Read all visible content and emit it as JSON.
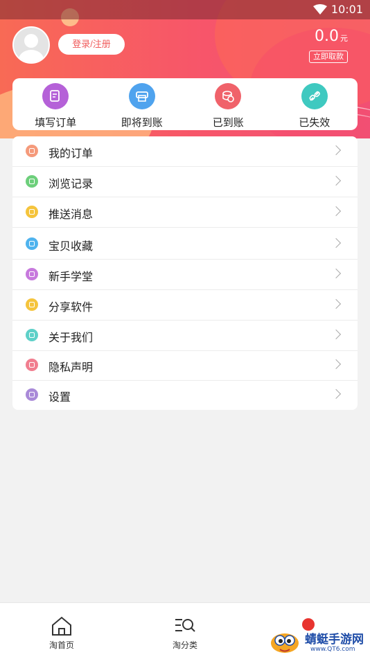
{
  "status_bar": {
    "time": "10:01",
    "wifi_icon": "wifi-icon"
  },
  "profile": {
    "avatar_icon": "default-avatar-icon",
    "login_label": "登录/注册",
    "balance_value": "0.0",
    "balance_unit": "元",
    "withdraw_label": "立即取款"
  },
  "stats": [
    {
      "label": "填写订单",
      "icon": "edit-document-icon",
      "color": "#b561d8"
    },
    {
      "label": "即将到账",
      "icon": "printer-icon",
      "color": "#4fa3ee"
    },
    {
      "label": "已到账",
      "icon": "coins-icon",
      "color": "#f0626a"
    },
    {
      "label": "已失效",
      "icon": "broken-link-icon",
      "color": "#3fc9c0"
    }
  ],
  "menu": [
    {
      "label": "我的订单",
      "icon": "order-icon",
      "color": "#f59a7b"
    },
    {
      "label": "浏览记录",
      "icon": "history-icon",
      "color": "#6dcf7b"
    },
    {
      "label": "推送消息",
      "icon": "bell-icon",
      "color": "#f5c43c"
    },
    {
      "label": "宝贝收藏",
      "icon": "heart-icon",
      "color": "#4fb3ee"
    },
    {
      "label": "新手学堂",
      "icon": "book-icon",
      "color": "#c779dd"
    },
    {
      "label": "分享软件",
      "icon": "share-icon",
      "color": "#f5c43c"
    },
    {
      "label": "关于我们",
      "icon": "info-icon",
      "color": "#5ed0c8"
    },
    {
      "label": "隐私声明",
      "icon": "lock-icon",
      "color": "#f17e8f"
    },
    {
      "label": "设置",
      "icon": "settings-icon",
      "color": "#a98ad8"
    }
  ],
  "bottom_nav": [
    {
      "label": "淘首页",
      "icon": "home-icon"
    },
    {
      "label": "淘分类",
      "icon": "category-search-icon"
    },
    {
      "label": "",
      "icon": "profile-icon"
    }
  ],
  "watermark": {
    "text": "蜻蜓手游网",
    "url": "www.QT6.com"
  },
  "colors": {
    "header_start": "#f86a55",
    "header_end": "#f05577",
    "accent": "#f05a5a"
  }
}
